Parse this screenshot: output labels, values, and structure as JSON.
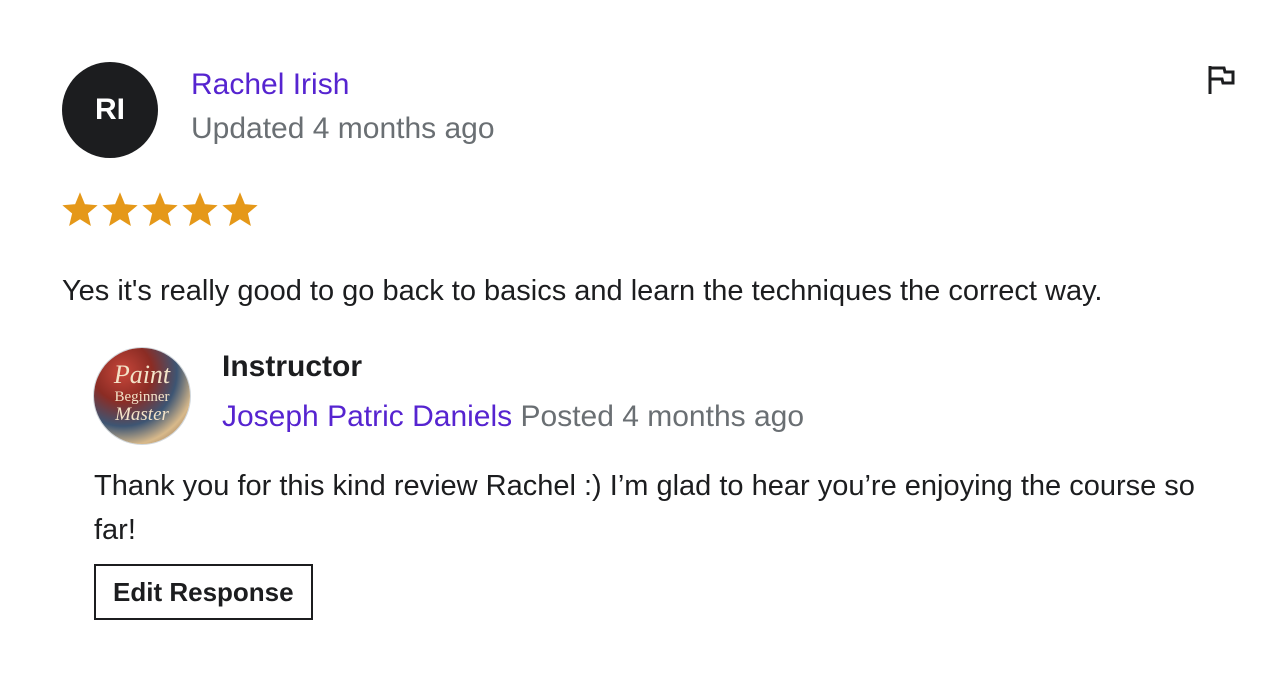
{
  "review": {
    "avatar_initials": "RI",
    "reviewer_name": "Rachel Irish",
    "meta": "Updated 4 months ago",
    "rating": 5,
    "rating_max": 5,
    "star_color": "#e59819",
    "text": "Yes it's really good to go back to basics and learn the techniques the correct way.",
    "flag_icon": "flag-icon"
  },
  "response": {
    "avatar_logo": [
      "Paint",
      "Beginner",
      "Master"
    ],
    "label": "Instructor",
    "instructor_name": "Joseph Patric Daniels",
    "posted": "Posted 4 months ago",
    "text": "Thank you for this kind review Rachel :) I’m glad to hear you’re enjoying the course so far!",
    "edit_button_label": "Edit Response"
  },
  "colors": {
    "link": "#5624d0",
    "muted": "#6a6f73",
    "text": "#1c1d1f"
  }
}
